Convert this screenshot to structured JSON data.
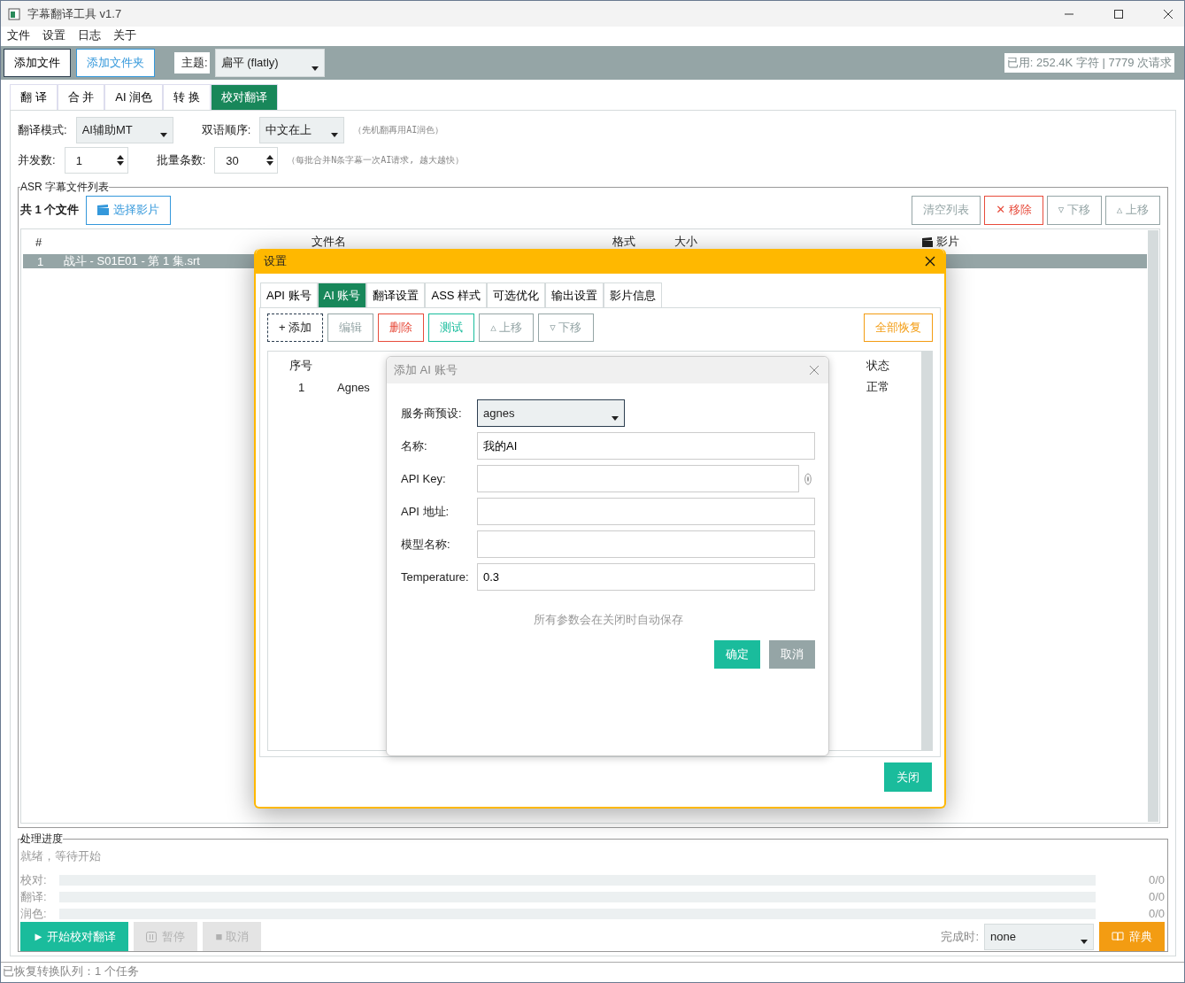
{
  "window": {
    "title": "字幕翻译工具 v1.7"
  },
  "menu": [
    "文件",
    "设置",
    "日志",
    "关于"
  ],
  "toolbar": {
    "buttons": [
      {
        "label": "添加文件",
        "focused": true
      },
      {
        "label": "添加文件夹",
        "focused": false
      }
    ],
    "theme_label": "主题:",
    "theme_value": "扁平 (flatly)",
    "usage": "已用: 252.4K 字符 | 7779 次请求"
  },
  "tabs": [
    {
      "label": "翻 译",
      "selected": false
    },
    {
      "label": "合 并",
      "selected": false
    },
    {
      "label": "AI 润色",
      "selected": false
    },
    {
      "label": "转 换",
      "selected": false
    },
    {
      "label": "校对翻译",
      "selected": true
    }
  ],
  "options": {
    "mode_label": "翻译模式:",
    "mode": "AI辅助MT",
    "order_label": "双语顺序:",
    "order": "中文在上",
    "mode_hint": "（先机翻再用AI润色）",
    "concurrency_label": "并发数:",
    "concurrency": "1",
    "batch_label": "批量条数:",
    "batch": "30",
    "batch_hint": "（每批合并N条字幕一次AI请求, 越大越快）"
  },
  "file_list": {
    "title": "ASR 字幕文件列表",
    "count": "共 1 个文件",
    "pick_button": "选择影片",
    "buttons": [
      {
        "label": "清空列表",
        "kind": "plain"
      },
      {
        "label": "✕ 移除",
        "kind": "danger"
      },
      {
        "label": "▿ 下移",
        "kind": "plain"
      },
      {
        "label": "▵ 上移",
        "kind": "plain"
      }
    ],
    "columns": [
      "#",
      "文件名",
      "格式",
      "大小",
      "影片"
    ],
    "rows": [
      {
        "cells": [
          "1",
          "战斗 - S01E01 - 第 1 集.srt"
        ],
        "selected": true
      }
    ]
  },
  "progress": {
    "title": "处理进度",
    "status": "就绪，等待开始",
    "bars": [
      {
        "label": "校对:",
        "level": 0,
        "reading": "0/0"
      },
      {
        "label": "翻译:",
        "level": 0,
        "reading": "0/0"
      },
      {
        "label": "润色:",
        "level": 0,
        "reading": "0/0"
      }
    ],
    "start": "► 开始校对翻译",
    "pause": {
      "label": "暂停",
      "disabled": true
    },
    "cancel": {
      "label": "■ 取消",
      "disabled": true
    },
    "done_label": "完成时:",
    "done_value": "none",
    "dict": "辞典"
  },
  "status_bar": "已恢复转换队列：1 个任务",
  "settings_dialog": {
    "title": "设置",
    "tabs": [
      {
        "label": "API 账号",
        "selected": false
      },
      {
        "label": "AI 账号",
        "selected": true
      },
      {
        "label": "翻译设置",
        "selected": false
      },
      {
        "label": "ASS 样式",
        "selected": false
      },
      {
        "label": "可选优化",
        "selected": false
      },
      {
        "label": "输出设置",
        "selected": false
      },
      {
        "label": "影片信息",
        "selected": false
      }
    ],
    "buttons": [
      {
        "label": "+ 添加",
        "kind": "focus"
      },
      {
        "label": "编辑",
        "kind": "plain"
      },
      {
        "label": "删除",
        "kind": "danger"
      },
      {
        "label": "测试",
        "kind": "success"
      },
      {
        "label": "▵ 上移",
        "kind": "plain"
      },
      {
        "label": "▿ 下移",
        "kind": "plain"
      }
    ],
    "restore": "全部恢复",
    "columns": [
      "序号",
      "状态"
    ],
    "rows": [
      {
        "index": "1",
        "name": "Agnes",
        "status": "正常"
      }
    ],
    "close": "关闭"
  },
  "add_dialog": {
    "title": "添加 AI 账号",
    "fields": [
      {
        "label": "服务商预设:",
        "kind": "select",
        "value": "agnes"
      },
      {
        "label": "名称:",
        "kind": "text",
        "value": "我的AI"
      },
      {
        "label": "API Key:",
        "kind": "secret"
      },
      {
        "label": "API 地址:",
        "kind": "text"
      },
      {
        "label": "模型名称:",
        "kind": "text"
      },
      {
        "label": "Temperature:",
        "kind": "text",
        "value": "0.3"
      }
    ],
    "hint": "所有参数会在关闭时自动保存",
    "ok": "确定",
    "cancel": "取消"
  }
}
